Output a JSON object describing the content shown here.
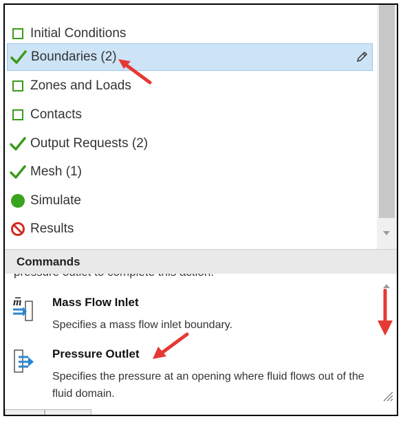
{
  "tree": {
    "items": [
      {
        "label": "Initial Conditions",
        "status": "incomplete"
      },
      {
        "label": "Boundaries (2)",
        "status": "complete",
        "selected": true
      },
      {
        "label": "Zones and Loads",
        "status": "incomplete"
      },
      {
        "label": "Contacts",
        "status": "incomplete"
      },
      {
        "label": "Output Requests (2)",
        "status": "complete"
      },
      {
        "label": "Mesh (1)",
        "status": "complete"
      },
      {
        "label": "Simulate",
        "status": "ready"
      },
      {
        "label": "Results",
        "status": "blocked"
      }
    ]
  },
  "commands": {
    "header": "Commands",
    "cut_text": "pressure outlet to complete this action.",
    "items": [
      {
        "title": "Mass Flow Inlet",
        "description": "Specifies a mass flow inlet boundary.",
        "icon": "mass-flow-inlet-icon"
      },
      {
        "title": "Pressure Outlet",
        "description": "Specifies the pressure at an opening where fluid flows out of the fluid domain.",
        "icon": "pressure-outlet-icon"
      }
    ]
  },
  "colors": {
    "check": "#3a9a1a",
    "selected_bg": "#cde4f7",
    "annotation_arrow": "#e53935",
    "results_icon": "#d42a1f"
  }
}
